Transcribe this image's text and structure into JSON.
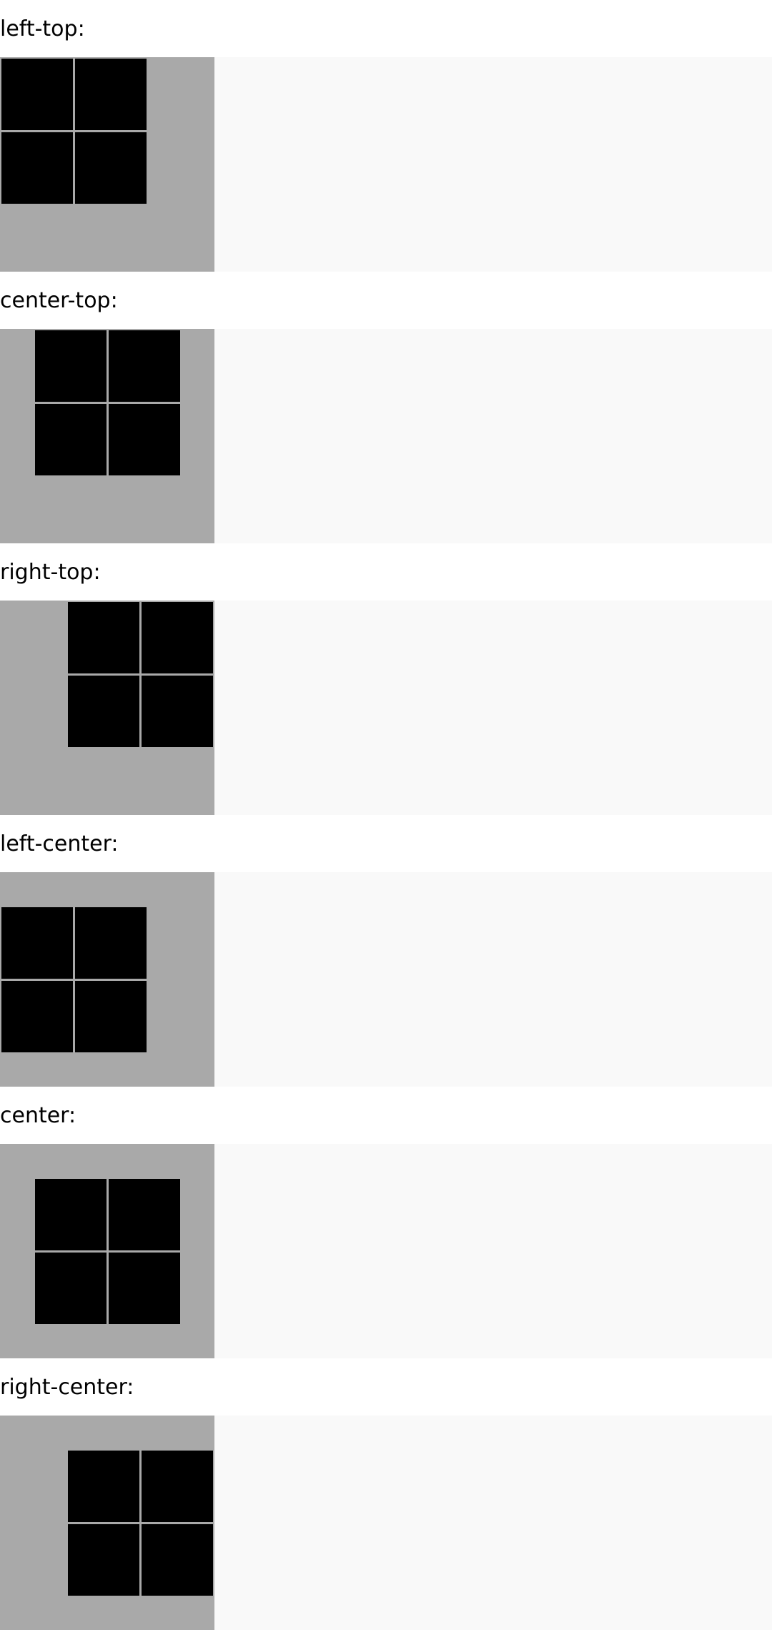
{
  "sections": [
    {
      "label": "left-top:"
    },
    {
      "label": "center-top:"
    },
    {
      "label": "right-top:"
    },
    {
      "label": "left-center:"
    },
    {
      "label": "center:"
    },
    {
      "label": "right-center:"
    }
  ],
  "colors": {
    "box_background": "#a9a9a9",
    "cell": "#000000",
    "row_background": "#f9f9f9",
    "page_background": "#ffffff"
  }
}
